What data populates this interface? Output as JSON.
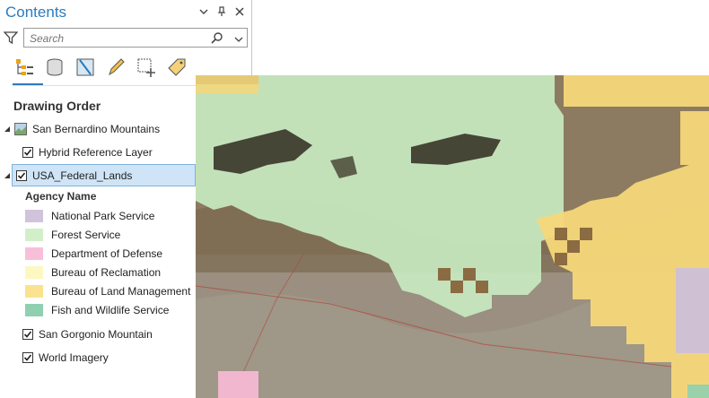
{
  "panel": {
    "title": "Contents",
    "search_placeholder": "Search",
    "section_title": "Drawing Order",
    "icons": [
      "filter-icon",
      "search-icon",
      "list-by-drawing-order-icon",
      "list-by-data-source-icon",
      "list-by-selection-icon",
      "list-by-editing-icon",
      "list-by-snapping-icon",
      "list-by-labeling-icon"
    ]
  },
  "layers": {
    "map_name": "San Bernardino Mountains",
    "items": [
      {
        "label": "Hybrid Reference Layer",
        "checked": true
      },
      {
        "label": "USA_Federal_Lands",
        "checked": true,
        "selected": true
      },
      {
        "label": "San Gorgonio Mountain",
        "checked": true
      },
      {
        "label": "World Imagery",
        "checked": true
      }
    ]
  },
  "legend": {
    "title": "Agency Name",
    "items": [
      {
        "label": "National Park Service",
        "color": "#d2c3dc"
      },
      {
        "label": "Forest Service",
        "color": "#d3efc9"
      },
      {
        "label": "Department of Defense",
        "color": "#f7c0d8"
      },
      {
        "label": "Bureau of Reclamation",
        "color": "#fdf8c2"
      },
      {
        "label": "Bureau of Land Management",
        "color": "#fbe28f"
      },
      {
        "label": "Fish and Wildlife Service",
        "color": "#8fd0b0"
      }
    ]
  },
  "colors": {
    "accent": "#2b7bbf",
    "selection": "#cfe4f6"
  }
}
